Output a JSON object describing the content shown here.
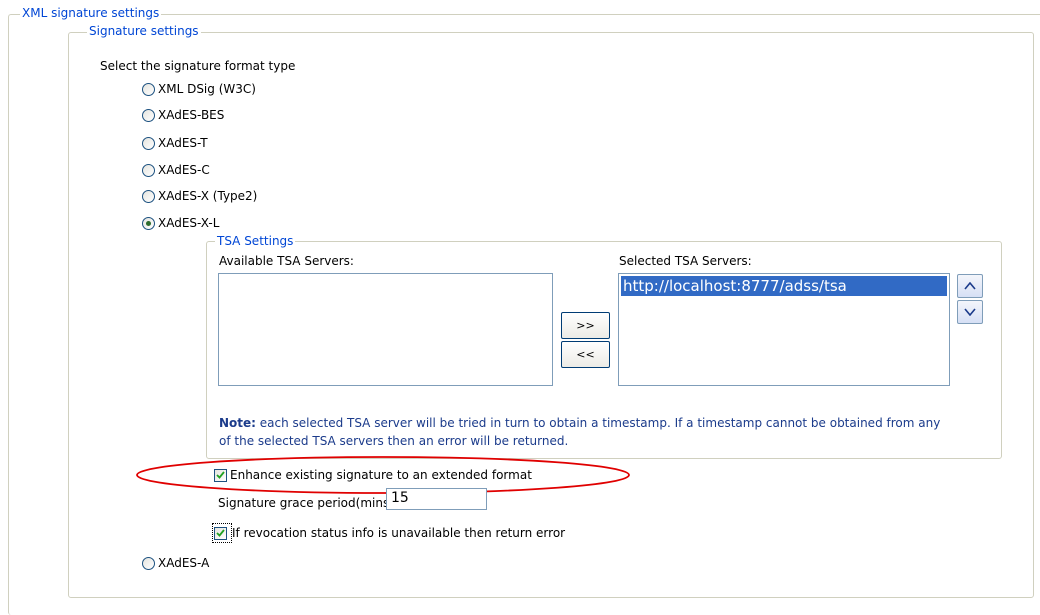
{
  "outer_group": {
    "legend": "XML signature settings"
  },
  "signature_group": {
    "legend": "Signature settings"
  },
  "format": {
    "prompt": "Select the signature format type",
    "options": [
      {
        "label": "XML DSig (W3C)",
        "selected": false
      },
      {
        "label": "XAdES-BES",
        "selected": false
      },
      {
        "label": "XAdES-T",
        "selected": false
      },
      {
        "label": "XAdES-C",
        "selected": false
      },
      {
        "label": "XAdES-X (Type2)",
        "selected": false
      },
      {
        "label": "XAdES-X-L",
        "selected": true
      },
      {
        "label": "XAdES-A",
        "selected": false
      }
    ]
  },
  "tsa": {
    "legend": "TSA Settings",
    "available_label": "Available TSA Servers:",
    "available_items": [],
    "selected_label": "Selected TSA Servers:",
    "selected_items": [
      "http://localhost:8777/adss/tsa"
    ],
    "add_button": ">>",
    "remove_button": "<<",
    "up_button": "^",
    "down_button": "v",
    "note_bold": "Note:",
    "note_line1": " each selected TSA server will be tried in turn to obtain a timestamp. If a timestamp cannot be obtained from any",
    "note_line2": "of the selected TSA servers then an error will be returned."
  },
  "options": {
    "enhance_label": "Enhance existing signature to an extended format",
    "enhance_checked": true,
    "grace_label": "Signature grace period(mins):",
    "grace_value": "15",
    "revocation_label": "If revocation status info is unavailable then return error",
    "revocation_checked": true
  },
  "colors": {
    "legend_text": "#0046d5",
    "highlight_ellipse": "#e00000",
    "selection_bg": "#316ac5"
  }
}
